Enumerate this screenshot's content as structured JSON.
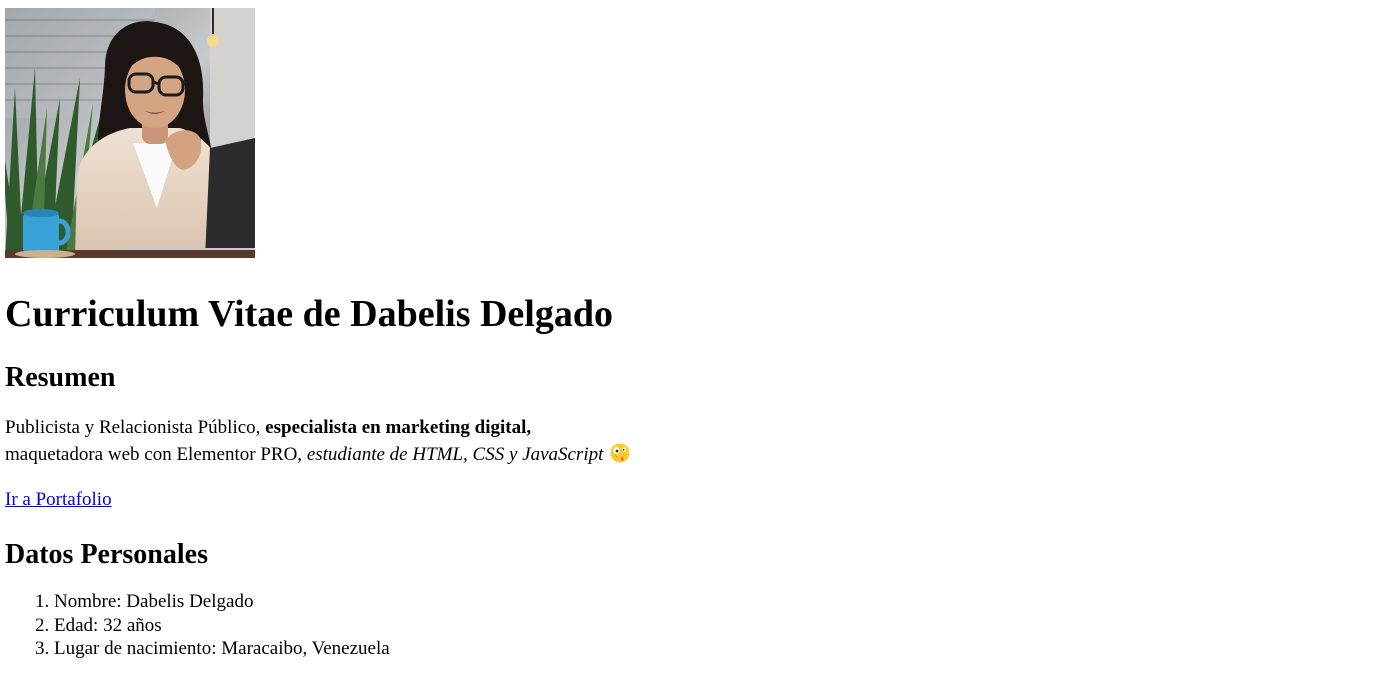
{
  "title": "Curriculum Vitae de Dabelis Delgado",
  "summary": {
    "heading": "Resumen",
    "line1_plain": "Publicista y Relacionista Público, ",
    "line1_bold": "especialista en marketing digital,",
    "line2_plain": "maquetadora web con Elementor PRO, ",
    "line2_italic": "estudiante de HTML, CSS y JavaScript",
    "emoji": "zany-face-emoji"
  },
  "portfolio_link": "Ir a Portafolio",
  "personal": {
    "heading": "Datos Personales",
    "items": [
      "Nombre: Dabelis Delgado",
      "Edad: 32 años",
      "Lugar de nacimiento: Maracaibo, Venezuela"
    ]
  },
  "colors": {
    "link": "#0000ee",
    "text": "#000000",
    "background": "#ffffff"
  }
}
